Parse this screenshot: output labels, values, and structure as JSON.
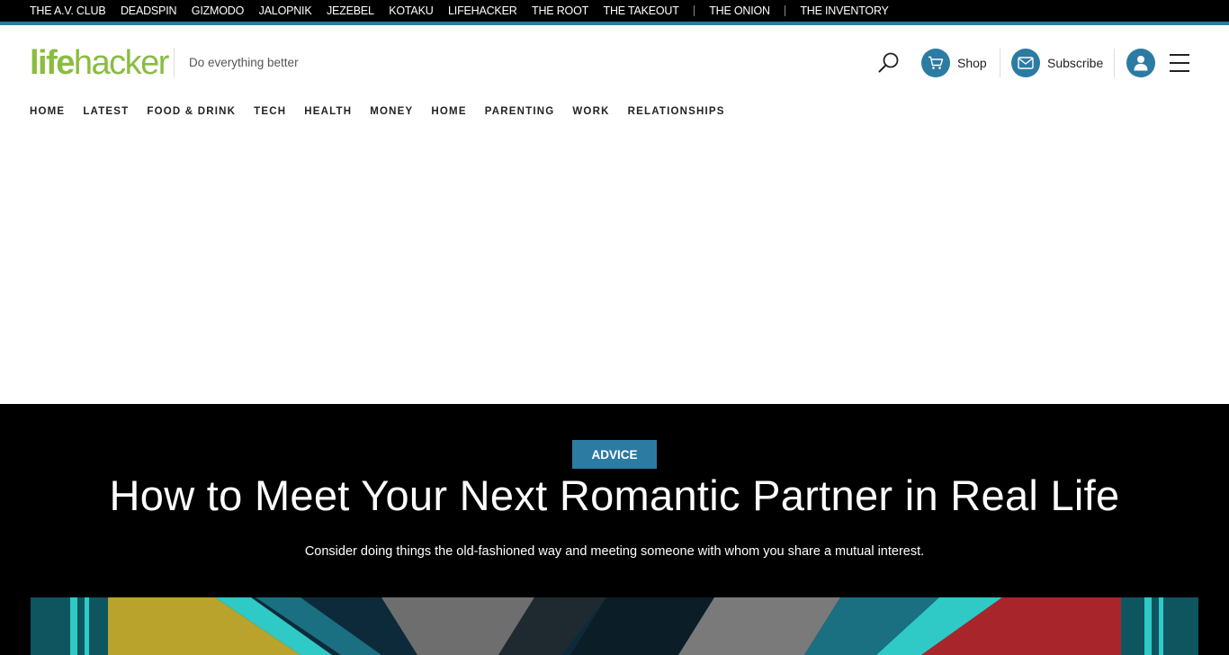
{
  "network": {
    "sites": [
      "THE A.V. CLUB",
      "DEADSPIN",
      "GIZMODO",
      "JALOPNIK",
      "JEZEBEL",
      "KOTAKU",
      "LIFEHACKER",
      "THE ROOT",
      "THE TAKEOUT"
    ],
    "extra_sites": [
      "THE ONION",
      "THE INVENTORY"
    ]
  },
  "header": {
    "logo_life": "life",
    "logo_hacker": "hacker",
    "tagline": "Do everything better",
    "shop_label": "Shop",
    "subscribe_label": "Subscribe"
  },
  "nav": {
    "items": [
      "HOME",
      "LATEST",
      "FOOD & DRINK",
      "TECH",
      "HEALTH",
      "MONEY",
      "HOME",
      "PARENTING",
      "WORK",
      "RELATIONSHIPS"
    ]
  },
  "article": {
    "category": "ADVICE",
    "title": "How to Meet Your Next Romantic Partner in Real Life",
    "subtitle": "Consider doing things the old-fashioned way and meeting someone with whom you share a mutual interest."
  },
  "colors": {
    "accent": "#2b7ba3",
    "logo_green": "#89bd3f"
  },
  "icons": {
    "search": "search-icon",
    "shop": "cart-icon",
    "subscribe": "mail-icon",
    "account": "user-icon",
    "menu": "hamburger-menu-icon"
  }
}
